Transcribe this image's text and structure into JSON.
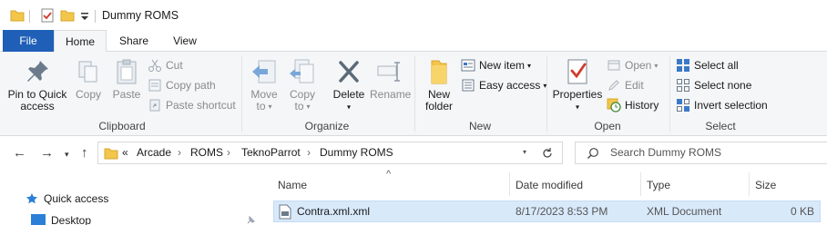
{
  "window": {
    "title": "Dummy ROMS"
  },
  "ribbon_tabs": [
    {
      "label": "File"
    },
    {
      "label": "Home"
    },
    {
      "label": "Share"
    },
    {
      "label": "View"
    }
  ],
  "clipboard": {
    "label": "Clipboard",
    "pin_line1": "Pin to Quick",
    "pin_line2": "access",
    "copy": "Copy",
    "paste": "Paste",
    "cut": "Cut",
    "copy_path": "Copy path",
    "paste_shortcut": "Paste shortcut"
  },
  "organize": {
    "label": "Organize",
    "move_to": "Move",
    "move_to_2": "to",
    "copy_to": "Copy",
    "copy_to_2": "to",
    "delete": "Delete",
    "rename": "Rename"
  },
  "new": {
    "label": "New",
    "new_folder_1": "New",
    "new_folder_2": "folder",
    "new_item": "New item",
    "easy_access": "Easy access"
  },
  "open": {
    "label": "Open",
    "properties": "Properties",
    "open": "Open",
    "edit": "Edit",
    "history": "History"
  },
  "select": {
    "label": "Select",
    "select_all": "Select all",
    "select_none": "Select none",
    "invert_selection": "Invert selection"
  },
  "address": {
    "overflow": "«",
    "segments": [
      "Arcade",
      "ROMS",
      "TeknoParrot",
      "Dummy ROMS"
    ],
    "separator": "›"
  },
  "search": {
    "placeholder": "Search Dummy ROMS"
  },
  "nav_pane": [
    {
      "label": "Quick access"
    },
    {
      "label": "Desktop"
    }
  ],
  "columns": [
    {
      "label": "Name"
    },
    {
      "label": "Date modified"
    },
    {
      "label": "Type"
    },
    {
      "label": "Size"
    }
  ],
  "files": [
    {
      "name": "Contra.xml.xml",
      "date": "8/17/2023 8:53 PM",
      "type": "XML Document",
      "size": "0 KB"
    }
  ],
  "colors": {
    "accent": "#1f5fb8",
    "selection": "#d8e9fa",
    "folder": "#f3c54b"
  }
}
